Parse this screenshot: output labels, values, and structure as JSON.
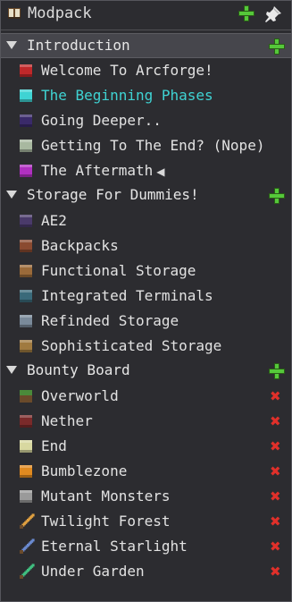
{
  "header": {
    "title": "Modpack",
    "icon": "book-icon",
    "add_icon": "plus-icon",
    "pin_icon": "pin-icon"
  },
  "sections": [
    {
      "label": "Introduction",
      "active": true,
      "items": [
        {
          "label": "Welcome To Arcforge!",
          "icon": "red-crystal-icon",
          "color": "#c0282a"
        },
        {
          "label": "The Beginning Phases",
          "icon": "sapling-icon",
          "color": "#3fd3d3",
          "highlight": true
        },
        {
          "label": "Going Deeper..",
          "icon": "obsidian-icon",
          "color": "#3a2a6a"
        },
        {
          "label": "Getting To The End? (Nope)",
          "icon": "scroll-icon",
          "color": "#a8b8a0"
        },
        {
          "label": "The Aftermath",
          "icon": "purple-creature-icon",
          "color": "#b030c0",
          "suffix": "◀"
        }
      ]
    },
    {
      "label": "Storage For Dummies!",
      "items": [
        {
          "label": "AE2",
          "icon": "storage-cell-icon",
          "color": "#4a3a6a"
        },
        {
          "label": "Backpacks",
          "icon": "backpack-icon",
          "color": "#8a4a30"
        },
        {
          "label": "Functional Storage",
          "icon": "drawer-icon",
          "color": "#9a6a3a"
        },
        {
          "label": "Integrated Terminals",
          "icon": "terminal-icon",
          "color": "#3a6a7a"
        },
        {
          "label": "Refinded Storage",
          "icon": "disk-drive-icon",
          "color": "#7a8a9a"
        },
        {
          "label": "Sophisticated Storage",
          "icon": "chest-icon",
          "color": "#a07a40"
        }
      ]
    },
    {
      "label": "Bounty Board",
      "items": [
        {
          "label": "Overworld",
          "icon": "grass-block-icon",
          "color": "#4a8a3a",
          "removable": true
        },
        {
          "label": "Nether",
          "icon": "netherrack-icon",
          "color": "#7a2a2a",
          "removable": true
        },
        {
          "label": "End",
          "icon": "end-stone-icon",
          "color": "#d8d8a0",
          "removable": true
        },
        {
          "label": "Bumblezone",
          "icon": "honeycomb-icon",
          "color": "#e08a20",
          "removable": true
        },
        {
          "label": "Mutant Monsters",
          "icon": "mutant-icon",
          "color": "#9a9a9a",
          "removable": true
        },
        {
          "label": "Twilight Forest",
          "icon": "sword-icon",
          "color": "#e0a040",
          "removable": true
        },
        {
          "label": "Eternal Starlight",
          "icon": "starlight-sword-icon",
          "color": "#6a8ad0",
          "removable": true
        },
        {
          "label": "Under Garden",
          "icon": "emerald-sword-icon",
          "color": "#40c080",
          "removable": true
        }
      ]
    }
  ],
  "remove_symbol": "✖"
}
